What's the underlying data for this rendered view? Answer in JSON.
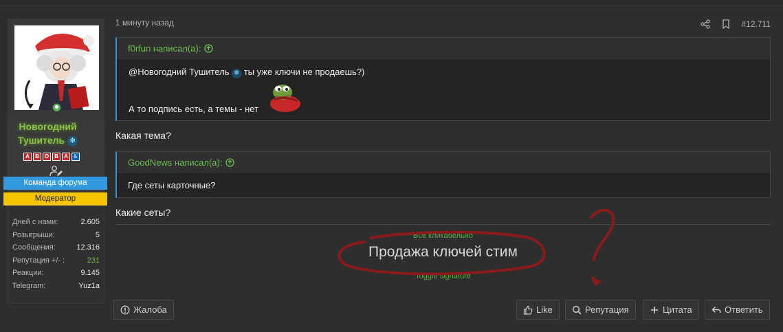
{
  "post": {
    "time": "1 минуту назад",
    "number": "#12.711"
  },
  "user": {
    "name_line1": "Новогодний",
    "name_line2": "Тушитель",
    "badges": [
      "A",
      "B",
      "O",
      "B",
      "A",
      "♿"
    ],
    "banner_team": "Команда форума",
    "banner_mod": "Модератор",
    "stats": [
      {
        "label": "Дней с нами:",
        "value": "2.605"
      },
      {
        "label": "Розыгрыши:",
        "value": "5"
      },
      {
        "label": "Сообщения:",
        "value": "12.316"
      },
      {
        "label": "Репутация +/- :",
        "value": "231"
      },
      {
        "label": "Реакции:",
        "value": "9.145"
      },
      {
        "label": "Telegram:",
        "value": "Yuz1a"
      }
    ]
  },
  "quotes": [
    {
      "author": "f0rfun написал(а):",
      "line1_mention": "@Новогодний Тушитель",
      "line1_rest": " ты уже ключи не продаешь?)",
      "line2": "А то подпись есть, а темы - нет"
    },
    {
      "author": "GoodNews написал(а):",
      "line1": "Где сеты карточные?"
    }
  ],
  "replies": {
    "reply1": "Какая тема?",
    "reply2": "Какие сеты?"
  },
  "signature": {
    "hint": "Всё кликабельно",
    "main": "Продажа ключей стим",
    "toggle": "Toggle signature"
  },
  "buttons": {
    "report": "Жалоба",
    "like": "Like",
    "reputation": "Репутация",
    "quote": "Цитата",
    "reply": "Ответить"
  },
  "colors": {
    "accent_green": "#6cbf4c",
    "quote_border": "#3c8ed6",
    "banner_team": "#3398dd",
    "banner_mod": "#f5c400",
    "scribble": "#8b1a1a"
  }
}
